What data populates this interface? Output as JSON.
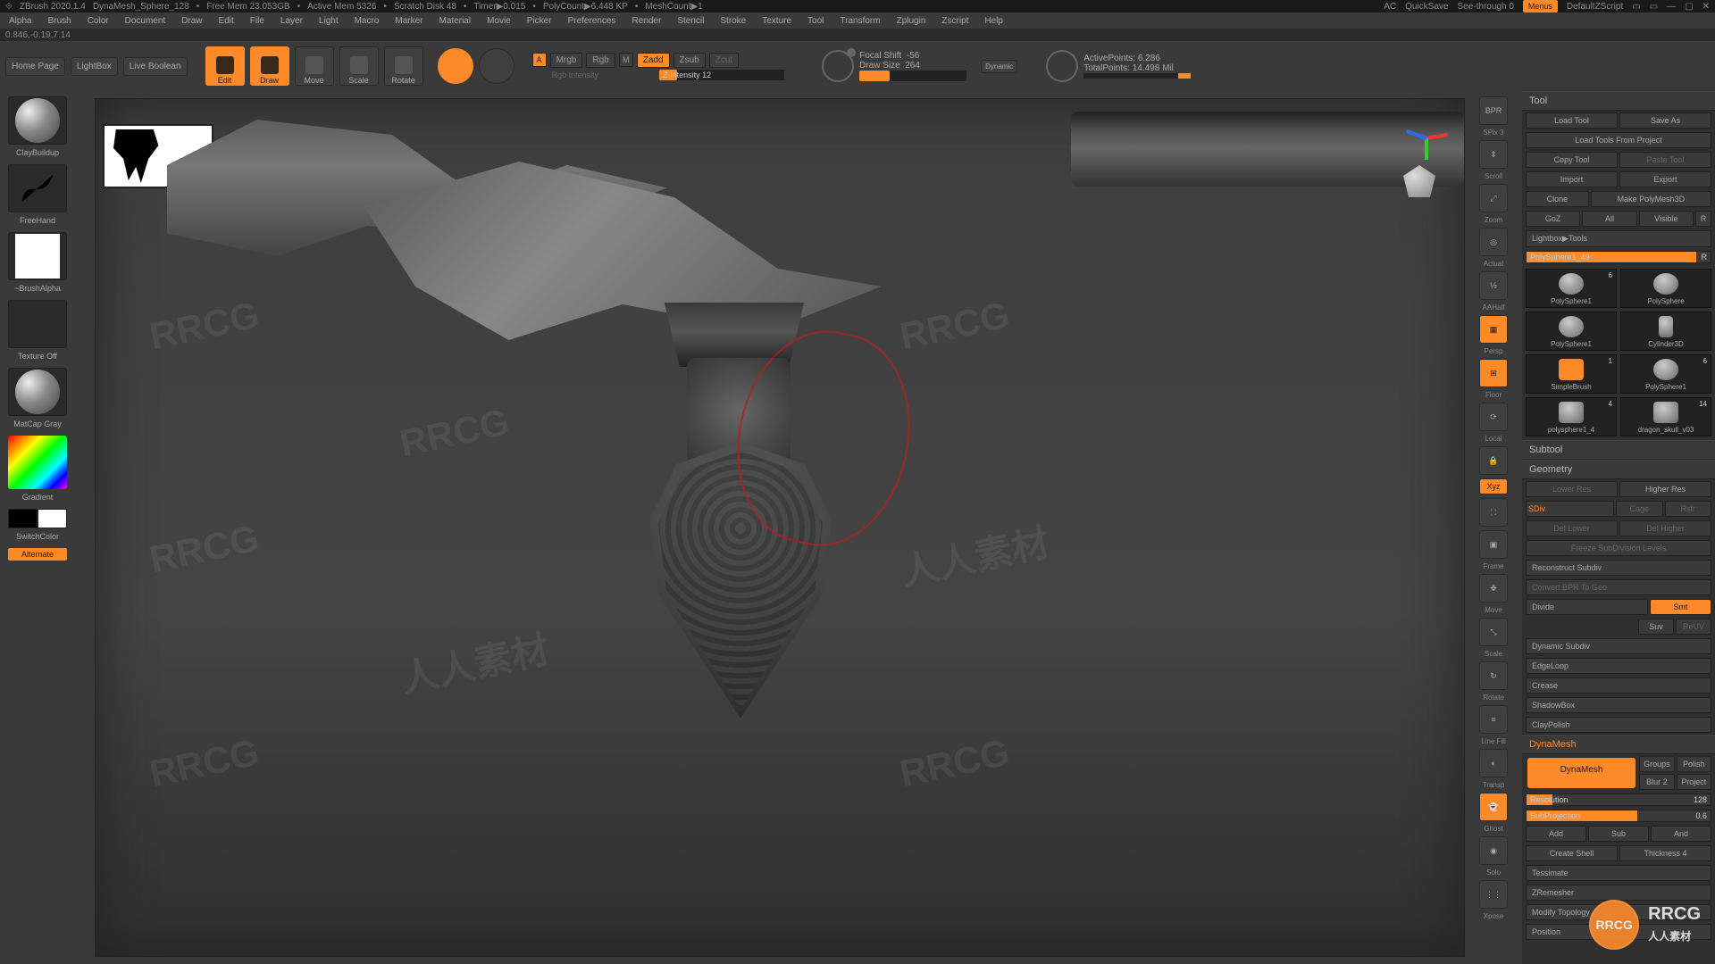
{
  "title": {
    "app": "ZBrush 2020.1.4",
    "doc": "DynaMesh_Sphere_128",
    "freemem": "Free Mem 23.053GB",
    "activemem": "Active Mem 5326",
    "scratch": "Scratch Disk 48",
    "timer": "Timer▶0.015",
    "polycount": "PolyCount▶6.448 KP",
    "meshcount": "MeshCount▶1",
    "ac": "AC",
    "quicksave": "QuickSave",
    "seethrough_label": "See-through",
    "seethrough_val": "0",
    "menus": "Menus",
    "script": "DefaultZScript"
  },
  "coords": "0.846,-0.19,7.14",
  "menu": [
    "Alpha",
    "Brush",
    "Color",
    "Document",
    "Draw",
    "Edit",
    "File",
    "Layer",
    "Light",
    "Macro",
    "Marker",
    "Material",
    "Movie",
    "Picker",
    "Preferences",
    "Render",
    "Stencil",
    "Stroke",
    "Texture",
    "Tool",
    "Transform",
    "Zplugin",
    "Zscript",
    "Help"
  ],
  "shelf": {
    "home": "Home Page",
    "lightbox": "LightBox",
    "livebool": "Live Boolean",
    "edit": "Edit",
    "draw": "Draw",
    "move": "Move",
    "scale": "Scale",
    "rotate": "Rotate"
  },
  "channels": {
    "a": "A",
    "mrgb": "Mrgb",
    "rgb": "Rgb",
    "m": "M",
    "zadd": "Zadd",
    "zsub": "Zsub",
    "zcut": "Zcut",
    "rgb_int_label": "Rgb Intensity",
    "z_int_label": "Z Intensity",
    "z_int_val": "12"
  },
  "draw": {
    "focal_label": "Focal Shift",
    "focal_val": "-56",
    "size_label": "Draw Size",
    "size_val": "264",
    "dynamic": "Dynamic"
  },
  "stats": {
    "active_label": "ActivePoints:",
    "active_val": "6.286",
    "total_label": "TotalPoints:",
    "total_val": "14.498 Mil"
  },
  "left": {
    "brush": "ClayBuildup",
    "stroke": "FreeHand",
    "alpha": "~BrushAlpha",
    "texture": "Texture Off",
    "material": "MatCap Gray",
    "gradient": "Gradient",
    "switch": "SwitchColor",
    "alternate": "Alternate"
  },
  "rnav": {
    "spix_label": "SPix",
    "spix_val": "3",
    "items": [
      "BPR",
      "Scroll",
      "Zoom",
      "Actual",
      "AAHalf",
      "Persp",
      "Floor",
      "Local",
      "Lock",
      "Xyz",
      "Fit",
      "Frame",
      "Move",
      "Scale",
      "Rotate",
      "Line Fill",
      "Transp",
      "Ghost",
      "Solo",
      "Xpose"
    ]
  },
  "tool": {
    "header": "Tool",
    "load": "Load Tool",
    "saveas": "Save As",
    "loadproj": "Load Tools From Project",
    "copy": "Copy Tool",
    "paste": "Paste Tool",
    "import": "Import",
    "export": "Export",
    "clone": "Clone",
    "makepoly": "Make PolyMesh3D",
    "goz": "GoZ",
    "all": "All",
    "visible": "Visible",
    "r": "R",
    "lightbox_tools": "Lightbox▶Tools",
    "current_tool": "PolySphere1_49",
    "thumbs": [
      {
        "name": "PolySphere1",
        "count": "6"
      },
      {
        "name": "PolySphere",
        "count": ""
      },
      {
        "name": "PolySphere1",
        "count": ""
      },
      {
        "name": "Cylinder3D",
        "count": ""
      },
      {
        "name": "SimpleBrush",
        "count": "1"
      },
      {
        "name": "PolySphere1",
        "count": "6"
      },
      {
        "name": "polysphere1_4",
        "count": "4"
      },
      {
        "name": "dragon_skull_v03",
        "count": "14"
      }
    ]
  },
  "subtool": {
    "header": "Subtool"
  },
  "geometry": {
    "header": "Geometry",
    "lower": "Lower Res",
    "higher": "Higher Res",
    "sdiv": "SDiv",
    "cage": "Cage",
    "rstr": "Rstr",
    "dellower": "Del Lower",
    "delhigher": "Del Higher",
    "freeze": "Freeze SubDivision Levels",
    "reconstruct": "Reconstruct Subdiv",
    "convert": "Convert BPR To Geo",
    "divide": "Divide",
    "smt": "Smt",
    "suv": "Suv",
    "reuv": "ReUV",
    "dynsub": "Dynamic Subdiv",
    "edgeloop": "EdgeLoop",
    "crease": "Crease",
    "shadowbox": "ShadowBox",
    "claypolish": "ClayPolish"
  },
  "dynamesh": {
    "header": "DynaMesh",
    "button": "DynaMesh",
    "groups": "Groups",
    "polish": "Polish",
    "blur": "Blur 2",
    "project": "Project",
    "res_label": "Resolution",
    "res_val": "128",
    "subproj_label": "SubProjection",
    "subproj_val": "0.6",
    "add": "Add",
    "sub": "Sub",
    "and": "And",
    "createshell": "Create Shell",
    "thickness_label": "Thickness",
    "thickness_val": "4"
  },
  "sections_tail": [
    "Tessimate",
    "ZRemesher",
    "Modify Topology",
    "Position"
  ],
  "watermark": {
    "en": "RRCG",
    "cn": "人人素材"
  }
}
